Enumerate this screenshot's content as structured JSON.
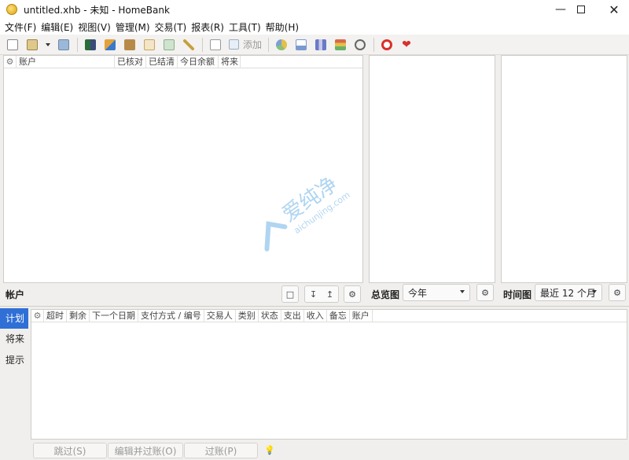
{
  "window": {
    "title": "untitled.xhb - 未知 - HomeBank",
    "minimize_icon": "minimize-icon",
    "maximize_icon": "maximize-icon",
    "close_icon": "close-icon"
  },
  "menubar": {
    "items": [
      "文件(F)",
      "编辑(E)",
      "视图(V)",
      "管理(M)",
      "交易(T)",
      "报表(R)",
      "工具(T)",
      "帮助(H)"
    ]
  },
  "toolbar": {
    "add_label": "添加",
    "icons": [
      "new-file-icon",
      "open-file-icon",
      "dropdown-arrow-icon",
      "save-icon",
      "accounts-icon",
      "payees-icon",
      "categories-icon",
      "scheduled-icon",
      "budget-icon",
      "assistant-icon",
      "show-transactions-icon",
      "add-transaction-icon",
      "statistics-icon",
      "trend-icon",
      "balance-icon",
      "budget-report-icon",
      "vehicle-cost-icon",
      "help-icon",
      "donate-icon"
    ]
  },
  "accounts_panel": {
    "columns": [
      "账户",
      "已核对",
      "已结清",
      "今日余额",
      "将来"
    ],
    "footer_label": "帐户"
  },
  "overview_panel": {
    "footer_label": "总览图",
    "range_value": "今年"
  },
  "timeline_panel": {
    "footer_label": "时间图",
    "range_value": "最近 12 个月"
  },
  "schedule_panel": {
    "tabs": [
      "计划",
      "将来",
      "提示"
    ],
    "active_tab": "计划",
    "columns": [
      "超时",
      "剩余",
      "下一个日期",
      "支付方式 / 编号",
      "交易人",
      "类别",
      "状态",
      "支出",
      "收入",
      "备忘",
      "账户"
    ],
    "actions": [
      "跳过(S)",
      "编辑并过账(O)",
      "过账(P)"
    ]
  },
  "watermark": {
    "text_cn": "爱纯净",
    "text_url": "aichunjing.com"
  },
  "colors": {
    "accent": "#2f6fd6",
    "heart": "#d9302c"
  }
}
